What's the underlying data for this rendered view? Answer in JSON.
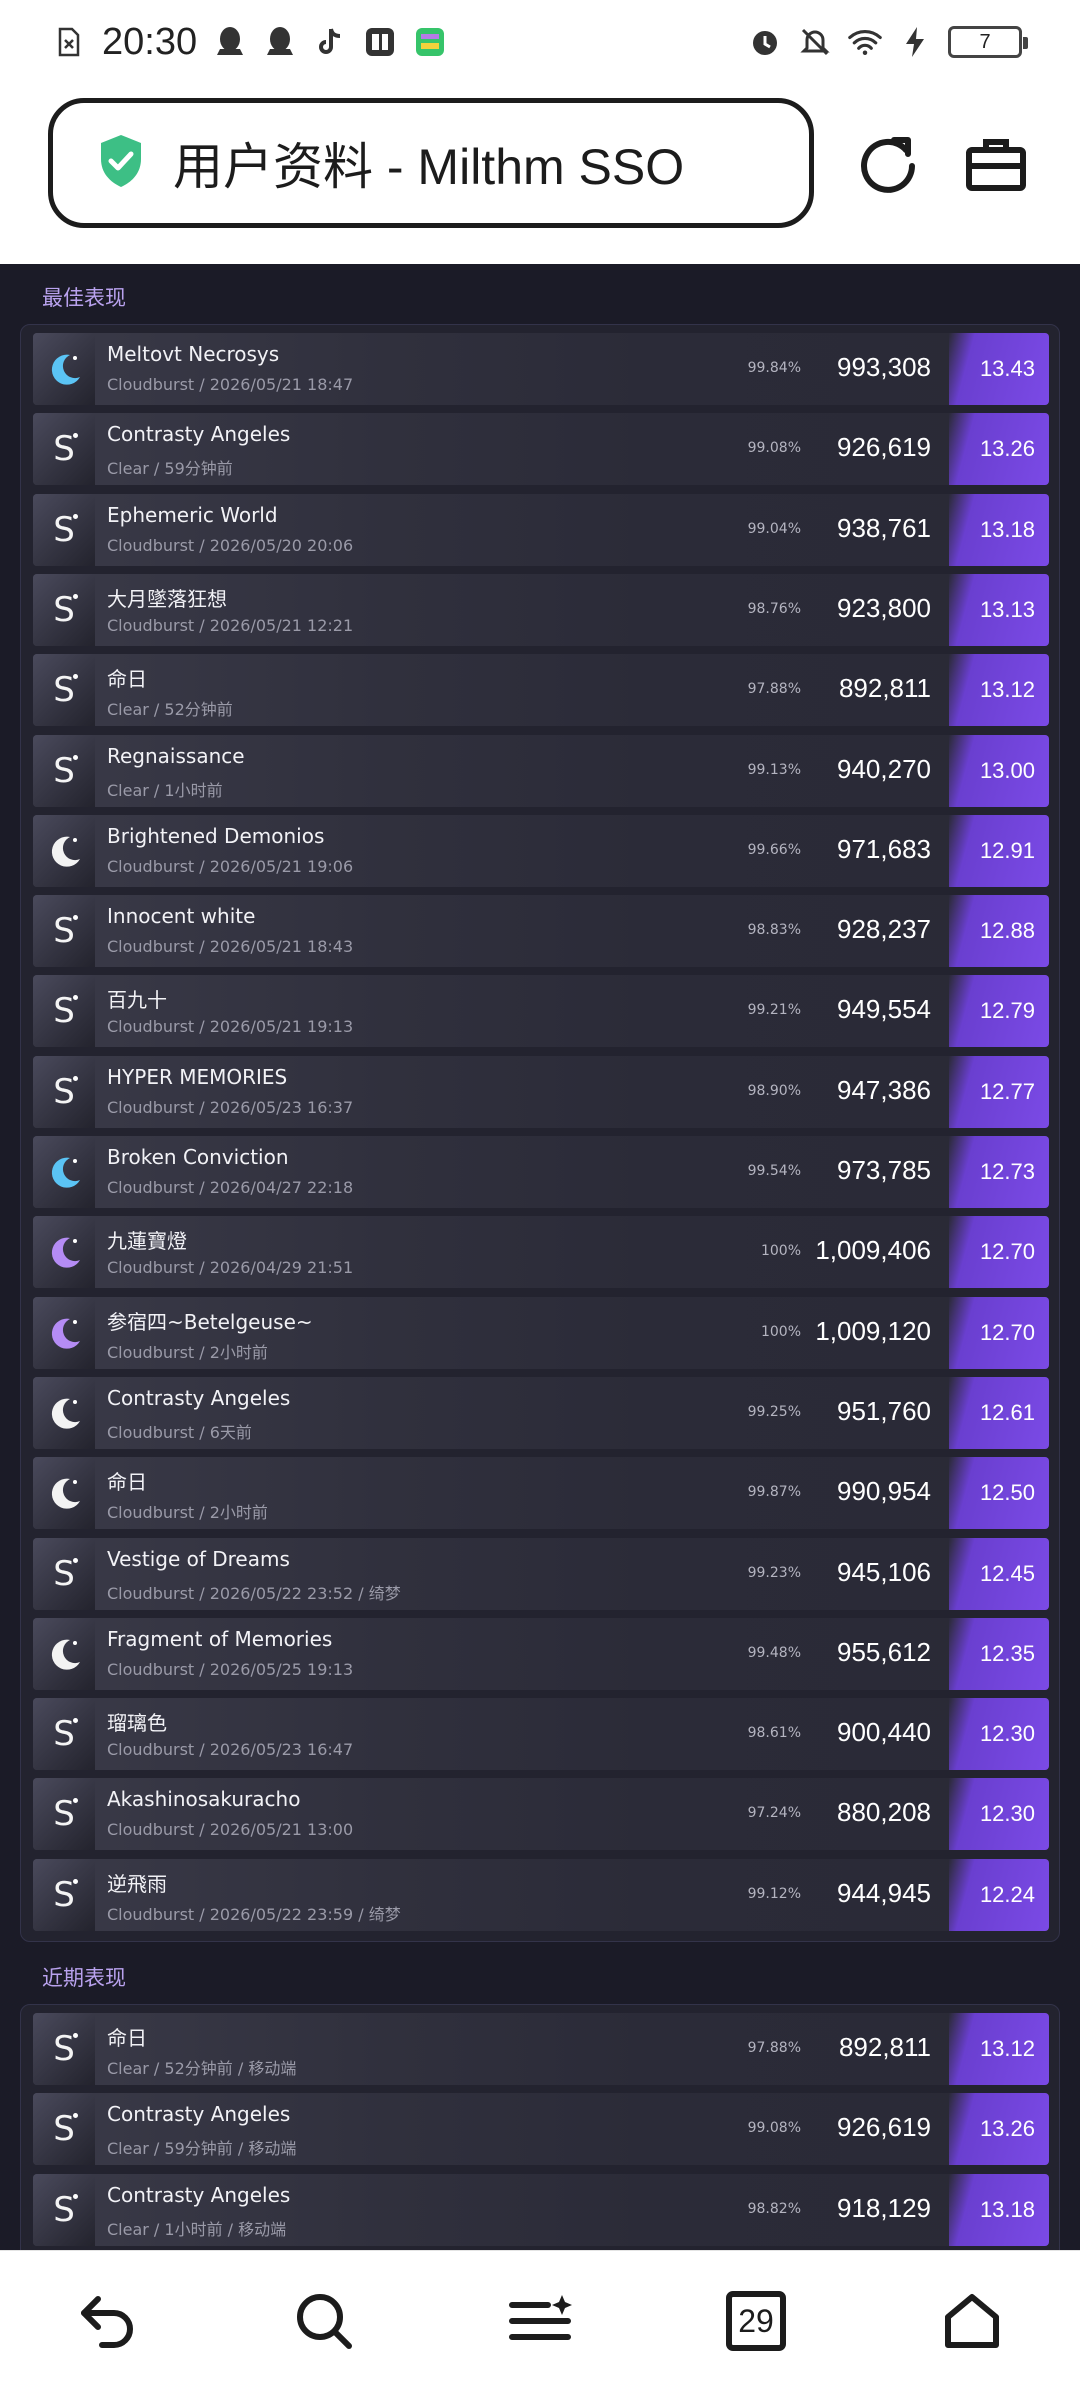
{
  "status_bar": {
    "time": "20:30",
    "battery": "7"
  },
  "browser": {
    "page_title": "用户资料 - Milthm SSO"
  },
  "best_section": {
    "title": "最佳表现",
    "rows": [
      {
        "song": "Meltovt Necrosys",
        "meta": "Cloudburst / 2026/05/21 18:47",
        "accuracy": "99.84%",
        "score": "993,308",
        "rating": "13.43",
        "icon": "moon-blue"
      },
      {
        "song": "Contrasty Angeles",
        "meta": "Clear / 59分钟前",
        "accuracy": "99.08%",
        "score": "926,619",
        "rating": "13.26",
        "icon": "s-rank"
      },
      {
        "song": "Ephemeric World",
        "meta": "Cloudburst / 2026/05/20 20:06",
        "accuracy": "99.04%",
        "score": "938,761",
        "rating": "13.18",
        "icon": "s-rank"
      },
      {
        "song": "大月墜落狂想",
        "meta": "Cloudburst / 2026/05/21 12:21",
        "accuracy": "98.76%",
        "score": "923,800",
        "rating": "13.13",
        "icon": "s-rank"
      },
      {
        "song": "命日",
        "meta": "Clear / 52分钟前",
        "accuracy": "97.88%",
        "score": "892,811",
        "rating": "13.12",
        "icon": "s-rank"
      },
      {
        "song": "Regnaissance",
        "meta": "Clear / 1小时前",
        "accuracy": "99.13%",
        "score": "940,270",
        "rating": "13.00",
        "icon": "s-rank"
      },
      {
        "song": "Brightened Demonios",
        "meta": "Cloudburst / 2026/05/21 19:06",
        "accuracy": "99.66%",
        "score": "971,683",
        "rating": "12.91",
        "icon": "moon-white"
      },
      {
        "song": "Innocent white",
        "meta": "Cloudburst / 2026/05/21 18:43",
        "accuracy": "98.83%",
        "score": "928,237",
        "rating": "12.88",
        "icon": "s-rank"
      },
      {
        "song": "百九十",
        "meta": "Cloudburst / 2026/05/21 19:13",
        "accuracy": "99.21%",
        "score": "949,554",
        "rating": "12.79",
        "icon": "s-rank"
      },
      {
        "song": "HYPER MEMORIES",
        "meta": "Cloudburst / 2026/05/23 16:37",
        "accuracy": "98.90%",
        "score": "947,386",
        "rating": "12.77",
        "icon": "s-rank"
      },
      {
        "song": "Broken Conviction",
        "meta": "Cloudburst / 2026/04/27 22:18",
        "accuracy": "99.54%",
        "score": "973,785",
        "rating": "12.73",
        "icon": "moon-blue"
      },
      {
        "song": "九蓮寶燈",
        "meta": "Cloudburst / 2026/04/29 21:51",
        "accuracy": "100%",
        "score": "1,009,406",
        "rating": "12.70",
        "icon": "moon-purple"
      },
      {
        "song": "参宿四~Betelgeuse~",
        "meta": "Cloudburst / 2小时前",
        "accuracy": "100%",
        "score": "1,009,120",
        "rating": "12.70",
        "icon": "moon-purple"
      },
      {
        "song": "Contrasty Angeles",
        "meta": "Cloudburst / 6天前",
        "accuracy": "99.25%",
        "score": "951,760",
        "rating": "12.61",
        "icon": "moon-white"
      },
      {
        "song": "命日",
        "meta": "Cloudburst / 2小时前",
        "accuracy": "99.87%",
        "score": "990,954",
        "rating": "12.50",
        "icon": "moon-white"
      },
      {
        "song": "Vestige of Dreams",
        "meta": "Cloudburst / 2026/05/22 23:52 / 绮梦",
        "accuracy": "99.23%",
        "score": "945,106",
        "rating": "12.45",
        "icon": "s-rank"
      },
      {
        "song": "Fragment of Memories",
        "meta": "Cloudburst / 2026/05/25 19:13",
        "accuracy": "99.48%",
        "score": "955,612",
        "rating": "12.35",
        "icon": "moon-white"
      },
      {
        "song": "瑠璃色",
        "meta": "Cloudburst / 2026/05/23 16:47",
        "accuracy": "98.61%",
        "score": "900,440",
        "rating": "12.30",
        "icon": "s-rank"
      },
      {
        "song": "Akashinosakuracho",
        "meta": "Cloudburst / 2026/05/21 13:00",
        "accuracy": "97.24%",
        "score": "880,208",
        "rating": "12.30",
        "icon": "s-rank"
      },
      {
        "song": "逆飛雨",
        "meta": "Cloudburst / 2026/05/22 23:59 / 绮梦",
        "accuracy": "99.12%",
        "score": "944,945",
        "rating": "12.24",
        "icon": "s-rank"
      }
    ]
  },
  "recent_section": {
    "title": "近期表现",
    "rows": [
      {
        "song": "命日",
        "meta": "Clear / 52分钟前 / 移动端",
        "accuracy": "97.88%",
        "score": "892,811",
        "rating": "13.12",
        "icon": "s-rank"
      },
      {
        "song": "Contrasty Angeles",
        "meta": "Clear / 59分钟前 / 移动端",
        "accuracy": "99.08%",
        "score": "926,619",
        "rating": "13.26",
        "icon": "s-rank"
      },
      {
        "song": "Contrasty Angeles",
        "meta": "Clear / 1小时前 / 移动端",
        "accuracy": "98.82%",
        "score": "918,129",
        "rating": "13.18",
        "icon": "s-rank"
      }
    ]
  },
  "bottom_nav": {
    "calendar_day": "29"
  },
  "colors": {
    "content_bg": "#1b1b27",
    "row_bg": "#30303d",
    "rating_accent": "#7b4ae6",
    "section_title": "#b9a2ee",
    "shield_green": "#3dbf85"
  }
}
